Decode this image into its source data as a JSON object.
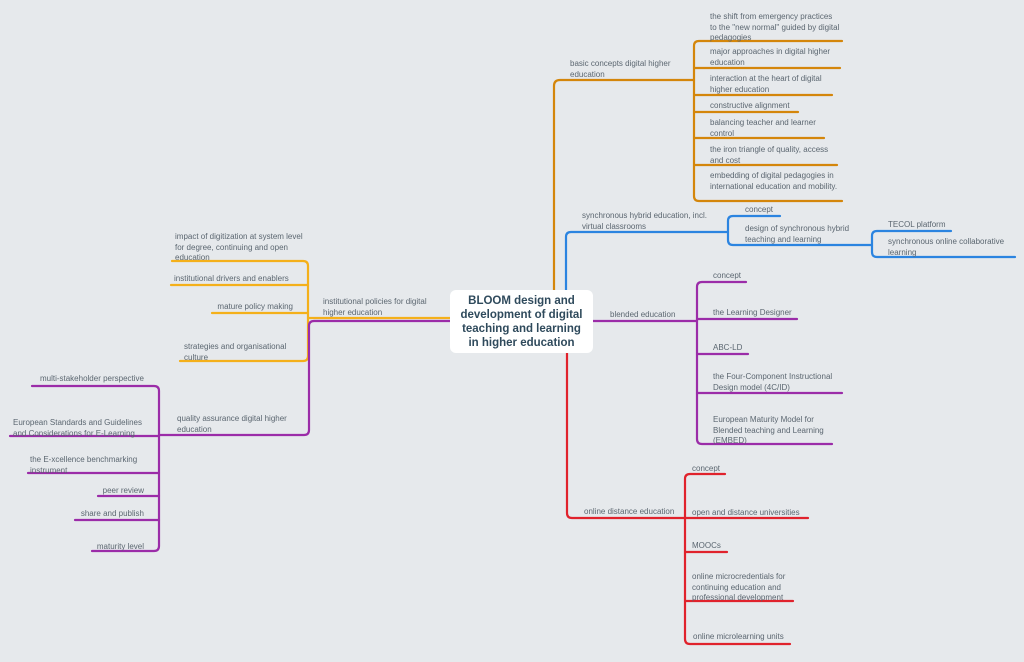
{
  "title": "BLOOM design and development of digital teaching and learning in higher education",
  "colors": {
    "background": "#e6e9ec",
    "basic_concepts": "#d4860b",
    "synchronous_hybrid": "#2b84e0",
    "blended": "#9b2ca8",
    "online_distance": "#e0222c",
    "institutional": "#f4b01a",
    "quality_assurance": "#9b2ca8"
  },
  "branches": {
    "basic": {
      "label": "basic concepts digital higher education",
      "children": [
        "the shift from emergency practices to the \"new normal\" guided by digital pedagogies",
        "major approaches in digital higher education",
        "interaction at the heart of digital higher education",
        "constructive alignment",
        "balancing teacher and learner control",
        "the iron triangle of quality, access and cost",
        "embedding of digital pedagogies in international education and mobility."
      ]
    },
    "sync": {
      "label": "synchronous hybrid education, incl. virtual classrooms",
      "children": [
        "concept",
        "design of synchronous hybrid teaching and learning"
      ],
      "grandchildren": [
        "TECOL platform",
        " synchronous online collaborative learning"
      ]
    },
    "blended": {
      "label": "blended  education",
      "children": [
        "concept",
        "the Learning Designer",
        "ABC-LD",
        "the Four-Component Instructional Design model (4C/ID)",
        "European Maturity Model for Blended teaching and Learning (EMBED)"
      ]
    },
    "online": {
      "label": "online distance education",
      "children": [
        "concept",
        "open  and distance universities",
        "MOOCs",
        "online microcredentials for continuing education and professional development",
        "online microlearning units"
      ]
    },
    "institutional": {
      "label": "institutional policies for digital higher education",
      "children": [
        "impact of digitization at system level for degree, continuing and open education",
        "institutional drivers and enablers",
        "mature policy making",
        "strategies and organisational culture"
      ]
    },
    "qa": {
      "label": "quality assurance digital higher education",
      "children": [
        "multi-stakeholder perspective",
        "European Standards and Guidelines and Considerations for E-Learning",
        "the E-xcellence benchmarking instrument",
        "peer review",
        "share and publish",
        "maturity level"
      ]
    }
  }
}
